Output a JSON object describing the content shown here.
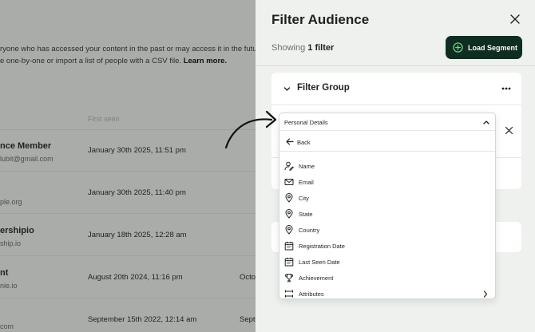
{
  "background": {
    "description_line1": "ryone who has accessed your content in the past or may access it in the future.",
    "description_line2": "e one-by-one or import a list of people with a CSV file.",
    "learn_more": "Learn more.",
    "column_first_seen": "First seen",
    "rows": [
      {
        "name": "nce Member",
        "email": "lubit@gmail.com",
        "first_seen": "January 30th 2025, 11:51 pm",
        "extra": ""
      },
      {
        "name": "",
        "email": "ple.org",
        "first_seen": "January 30th 2025, 11:40 pm",
        "extra": ""
      },
      {
        "name": "ershipio",
        "email": "ship.io",
        "first_seen": "January 18th 2025, 12:28 am",
        "extra": ""
      },
      {
        "name": "nt",
        "email": "nie.io",
        "first_seen": "August 20th 2024, 11:16 pm",
        "extra": "Octo"
      },
      {
        "name": "",
        "email": "com",
        "first_seen": "September 15th 2022, 12:14 am",
        "extra": "Septe"
      }
    ]
  },
  "drawer": {
    "title": "Filter Audience",
    "showing_prefix": "Showing",
    "showing_count": "1 filter",
    "load_segment_label": "Load Segment",
    "filter_group_title": "Filter Group"
  },
  "dropdown": {
    "selected": "Personal Details",
    "back_label": "Back",
    "items": [
      {
        "label": "Name",
        "icon": "user-edit-icon"
      },
      {
        "label": "Email",
        "icon": "mail-icon"
      },
      {
        "label": "City",
        "icon": "map-pin-icon"
      },
      {
        "label": "State",
        "icon": "map-pin-icon"
      },
      {
        "label": "Country",
        "icon": "map-pin-icon"
      },
      {
        "label": "Registration Date",
        "icon": "calendar-icon"
      },
      {
        "label": "Last Seen Date",
        "icon": "calendar-icon"
      },
      {
        "label": "Achievement",
        "icon": "trophy-icon"
      },
      {
        "label": "Attributes",
        "icon": "attributes-icon"
      }
    ]
  },
  "colors": {
    "accent_dark": "#0f2e22",
    "accent_green": "#7ad48a",
    "overlay": "#a9aca8",
    "drawer_bg": "#eef1ed"
  }
}
